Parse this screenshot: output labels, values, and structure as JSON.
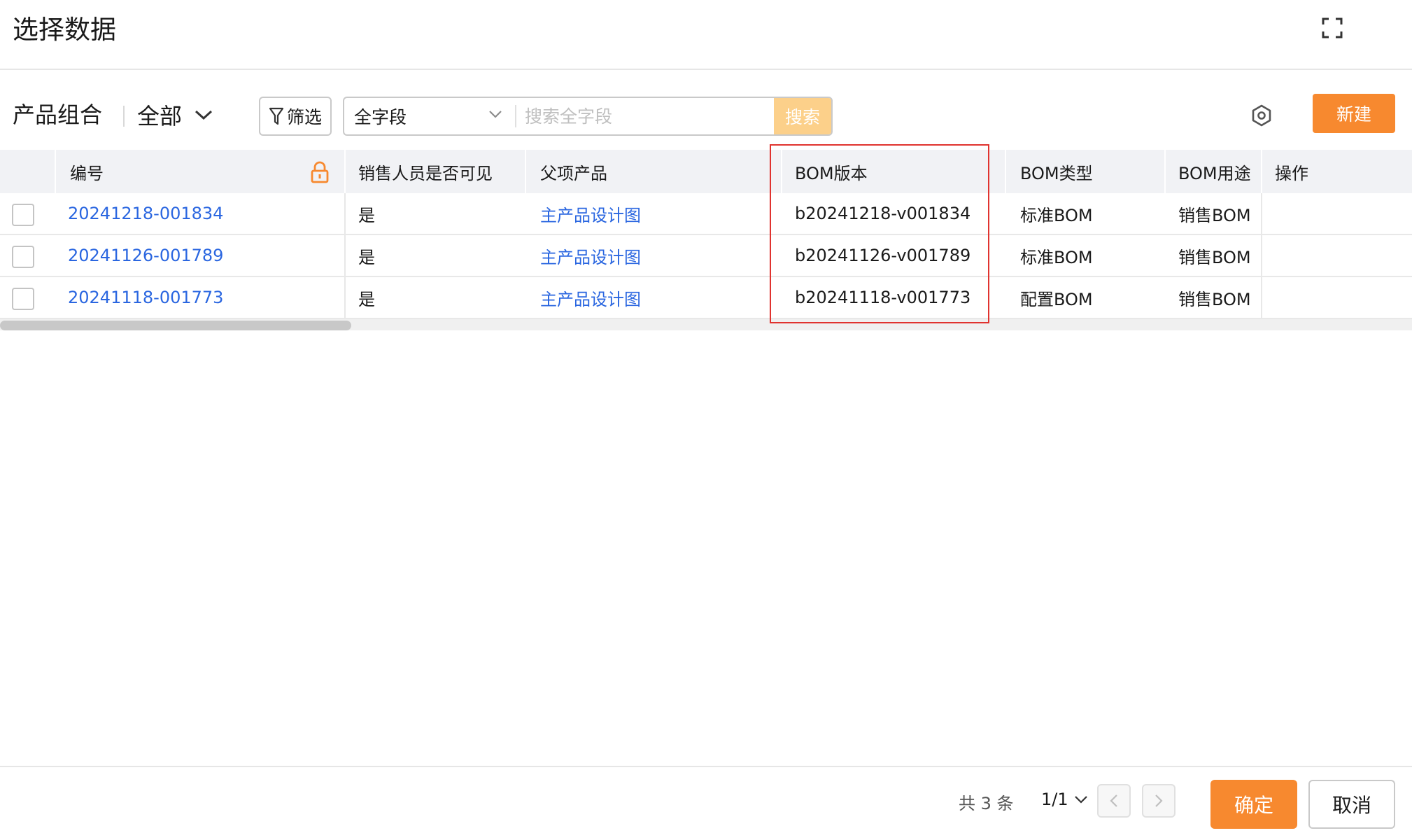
{
  "dialog": {
    "title": "选择数据",
    "fullscreen_icon": "expand-icon"
  },
  "toolbar": {
    "scene_label": "产品组合",
    "scope": "全部",
    "filter_label": "筛选",
    "field_select": "全字段",
    "search_placeholder": "搜索全字段",
    "search_label": "搜索",
    "new_label": "新建",
    "settings_icon": "settings-hex-icon"
  },
  "table": {
    "columns": [
      "编号",
      "销售人员是否可见",
      "父项产品",
      "BOM版本",
      "BOM类型",
      "BOM用途",
      "操作"
    ],
    "rows": [
      {
        "code": "20241218-001834",
        "visible": "是",
        "parent": "主产品设计图",
        "version": "b20241218-v001834",
        "type": "标准BOM",
        "usage": "销售BOM"
      },
      {
        "code": "20241126-001789",
        "visible": "是",
        "parent": "主产品设计图",
        "version": "b20241126-v001789",
        "type": "标准BOM",
        "usage": "销售BOM"
      },
      {
        "code": "20241118-001773",
        "visible": "是",
        "parent": "主产品设计图",
        "version": "b20241118-v001773",
        "type": "配置BOM",
        "usage": "销售BOM"
      }
    ]
  },
  "footer": {
    "total": "共 3 条",
    "page": "1/1",
    "confirm_label": "确定",
    "cancel_label": "取消"
  },
  "colors": {
    "accent": "#f7892f",
    "link": "#2a66e0",
    "highlight": "#e0332f"
  }
}
